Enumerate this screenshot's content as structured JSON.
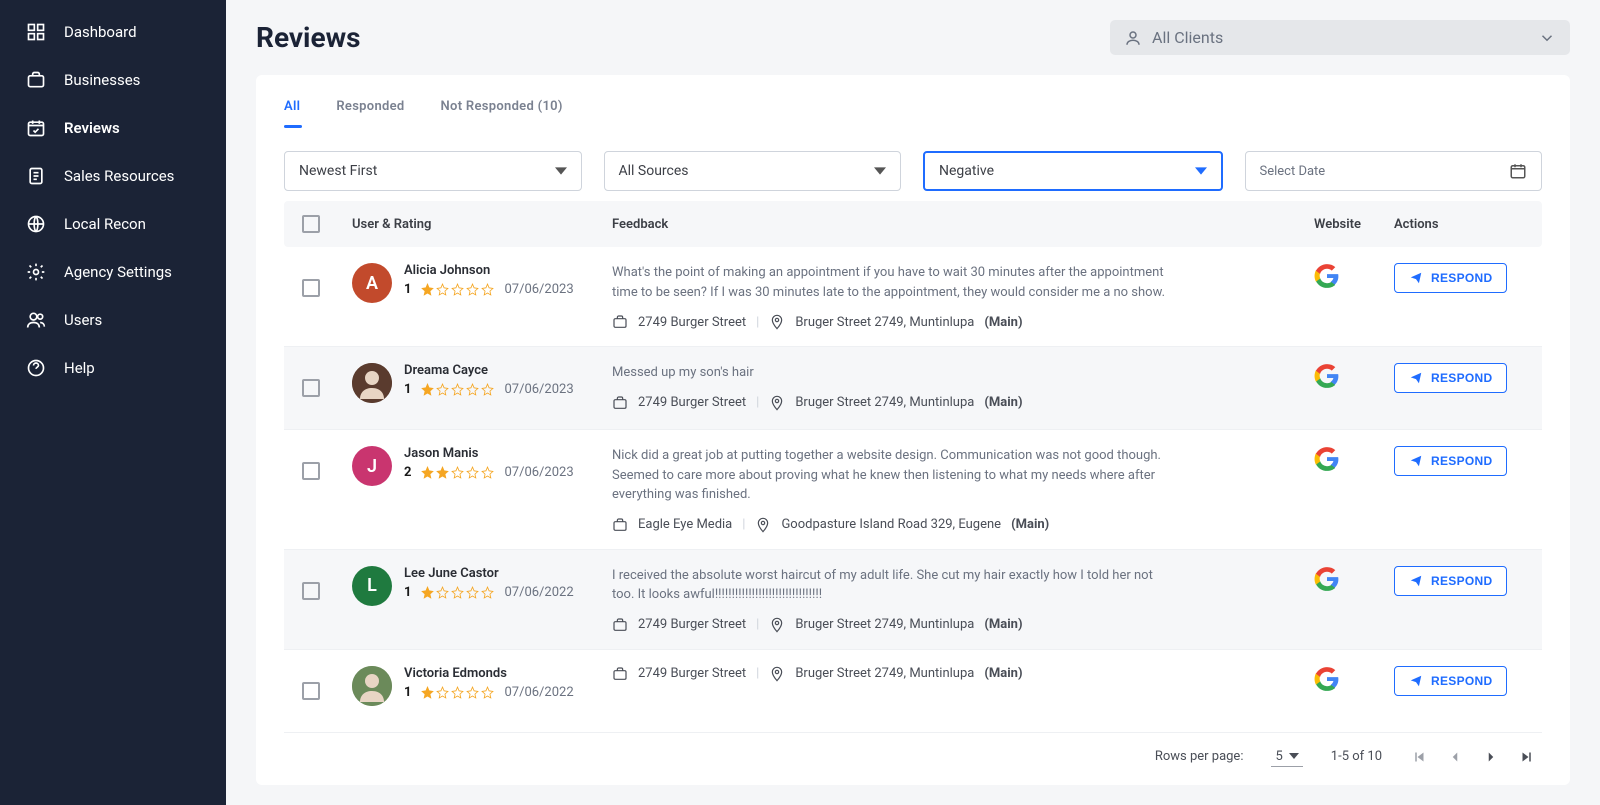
{
  "sidebar": {
    "items": [
      {
        "label": "Dashboard",
        "icon": "dashboard-icon"
      },
      {
        "label": "Businesses",
        "icon": "briefcase-icon"
      },
      {
        "label": "Reviews",
        "icon": "calendar-check-icon",
        "active": true
      },
      {
        "label": "Sales Resources",
        "icon": "document-icon"
      },
      {
        "label": "Local Recon",
        "icon": "globe-icon"
      },
      {
        "label": "Agency Settings",
        "icon": "gear-icon"
      },
      {
        "label": "Users",
        "icon": "users-icon"
      },
      {
        "label": "Help",
        "icon": "help-icon"
      }
    ]
  },
  "header": {
    "title": "Reviews",
    "client_select_label": "All Clients"
  },
  "tabs": [
    {
      "label": "All",
      "active": true
    },
    {
      "label": "Responded"
    },
    {
      "label": "Not Responded (10)"
    }
  ],
  "filters": {
    "sort": "Newest First",
    "source": "All Sources",
    "sentiment": "Negative",
    "date": "Select Date"
  },
  "table": {
    "headers": {
      "user": "User & Rating",
      "feedback": "Feedback",
      "website": "Website",
      "actions": "Actions"
    },
    "respond_label": "RESPOND",
    "main_tag": "(Main)",
    "rows": [
      {
        "name": "Alicia Johnson",
        "initial": "A",
        "avatar_bg": "#c24a2c",
        "rating": 1,
        "date": "07/06/2023",
        "feedback": "What's the point of making an appointment if you have to wait 30 minutes after the appointment time to be seen? If I was 30 minutes late to the appointment, they would consider me a no show.",
        "business": "2749 Burger Street",
        "address": "Bruger Street 2749, Muntinlupa"
      },
      {
        "name": "Dreama Cayce",
        "initial": "",
        "avatar_bg": "#5a3b2e",
        "avatar_img": true,
        "rating": 1,
        "date": "07/06/2023",
        "feedback": "Messed up my son's hair",
        "business": "2749 Burger Street",
        "address": "Bruger Street 2749, Muntinlupa"
      },
      {
        "name": "Jason Manis",
        "initial": "J",
        "avatar_bg": "#c9356f",
        "rating": 2,
        "date": "07/06/2023",
        "feedback": "Nick did a great job at putting together a website design. Communication was not good though. Seemed to care more about proving what he knew then listening to what my needs where after everything was finished.",
        "business": "Eagle Eye Media",
        "address": "Goodpasture Island Road 329, Eugene"
      },
      {
        "name": "Lee June Castor",
        "initial": "L",
        "avatar_bg": "#1f7a3f",
        "rating": 1,
        "date": "07/06/2022",
        "feedback": "I received the absolute worst haircut of my adult life. She cut my hair exactly how I told her not too. It looks awful!!!!!!!!!!!!!!!!!!!!!!!!!!!!!!!!",
        "business": "2749 Burger Street",
        "address": "Bruger Street 2749, Muntinlupa"
      },
      {
        "name": "Victoria Edmonds",
        "initial": "",
        "avatar_bg": "#6b8a5a",
        "avatar_img": true,
        "rating": 1,
        "date": "07/06/2022",
        "feedback": "",
        "business": "2749 Burger Street",
        "address": "Bruger Street 2749, Muntinlupa"
      }
    ]
  },
  "pagination": {
    "rows_label": "Rows per page:",
    "per_page": "5",
    "range": "1-5 of 10"
  }
}
